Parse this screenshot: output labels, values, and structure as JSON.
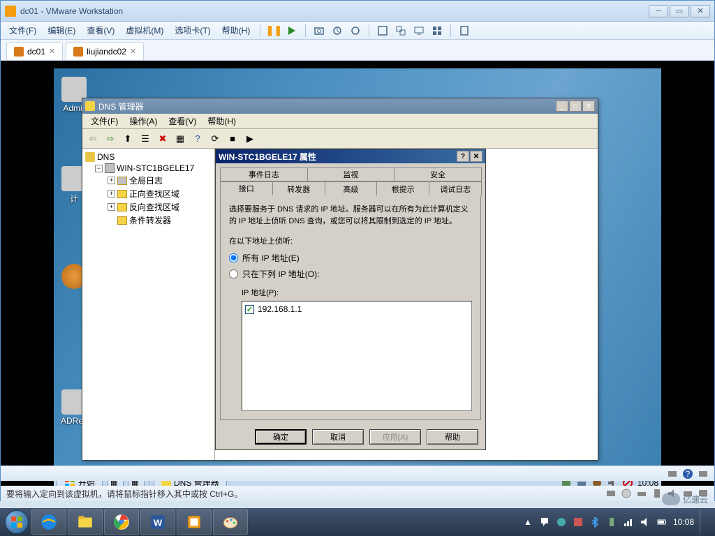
{
  "vmware": {
    "title": "dc01 - VMware Workstation",
    "menu": {
      "file": "文件(F)",
      "edit": "编辑(E)",
      "view": "查看(V)",
      "vm": "虚拟机(M)",
      "tabs": "选项卡(T)",
      "help": "帮助(H)"
    },
    "tabs": [
      {
        "label": "dc01"
      },
      {
        "label": "liujiandc02"
      }
    ],
    "status": "要将输入定向到该虚拟机，请将鼠标指针移入其中或按 Ctrl+G。"
  },
  "guest": {
    "desk_icons": {
      "admin": "Admir",
      "computer": "计",
      "adrec": "ADRec"
    },
    "dns_mgr": {
      "title": "DNS 管理器",
      "menu": {
        "file": "文件(F)",
        "action": "操作(A)",
        "view": "查看(V)",
        "help": "帮助(H)"
      },
      "tree": {
        "root": "DNS",
        "server": "WIN-STC1BGELE17",
        "global_log": "全局日志",
        "fwd_zone": "正向查找区域",
        "rev_zone": "反向查找区域",
        "cond_fwd": "条件转发器"
      }
    },
    "props": {
      "title": "WIN-STC1BGELE17 属性",
      "tabs_back": {
        "event_log": "事件日志",
        "monitor": "监视",
        "security": "安全"
      },
      "tabs_front": {
        "interfaces": "接口",
        "forwarders": "转发器",
        "advanced": "高级",
        "root_hints": "根提示",
        "debug_log": "调试日志"
      },
      "description": "选择要服务于 DNS 请求的 IP 地址。服务器可以在所有为此计算机定义的 IP 地址上侦听 DNS 查询，或您可以将其限制到选定的 IP 地址。",
      "listen_label": "在以下地址上侦听:",
      "radio_all": "所有 IP 地址(E)",
      "radio_only": "只在下列 IP 地址(O):",
      "ip_label": "IP 地址(P):",
      "ip_items": [
        "192.168.1.1"
      ],
      "buttons": {
        "ok": "确定",
        "cancel": "取消",
        "apply": "应用(A)",
        "help": "帮助"
      }
    },
    "taskbar": {
      "start": "开始",
      "task_dns": "DNS 管理器",
      "clock": "10:08"
    }
  },
  "host": {
    "clock_time": "10:08",
    "clock_date": "",
    "watermark": "亿速云"
  }
}
